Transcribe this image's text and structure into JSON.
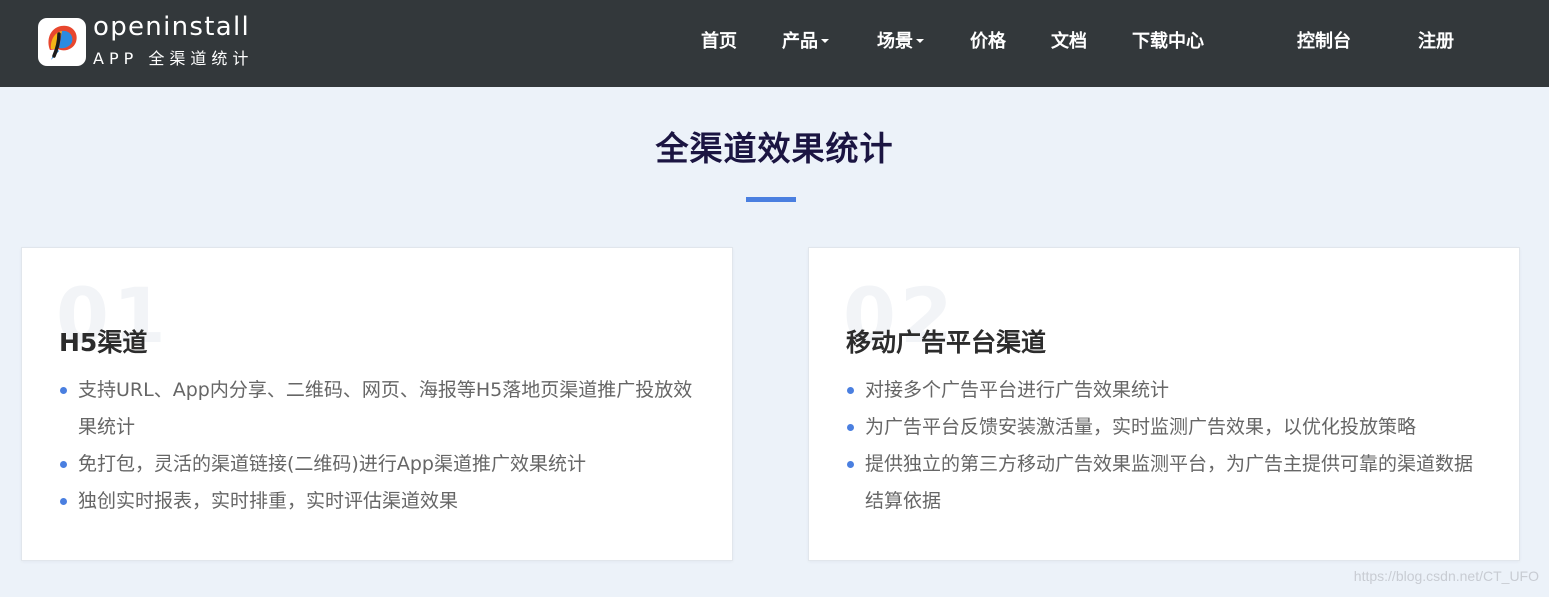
{
  "header": {
    "brand": {
      "name": "openinstall",
      "tagline": "APP 全渠道统计"
    },
    "nav": [
      {
        "label": "首页",
        "has_dropdown": false
      },
      {
        "label": "产品",
        "has_dropdown": true
      },
      {
        "label": "场景",
        "has_dropdown": true
      },
      {
        "label": "价格",
        "has_dropdown": false
      },
      {
        "label": "文档",
        "has_dropdown": false
      },
      {
        "label": "下载中心",
        "has_dropdown": false
      }
    ],
    "console_label": "控制台",
    "register_label": "注册"
  },
  "section": {
    "title": "全渠道效果统计"
  },
  "cards": [
    {
      "number": "01",
      "title": "H5渠道",
      "points": [
        "支持URL、App内分享、二维码、网页、海报等H5落地页渠道推广投放效果统计",
        "免打包，灵活的渠道链接(二维码)进行App渠道推广效果统计",
        "独创实时报表，实时排重，实时评估渠道效果"
      ]
    },
    {
      "number": "02",
      "title": "移动广告平台渠道",
      "points": [
        "对接多个广告平台进行广告效果统计",
        "为广告平台反馈安装激活量，实时监测广告效果，以优化投放策略",
        "提供独立的第三方移动广告效果监测平台，为广告主提供可靠的渠道数据结算依据"
      ]
    }
  ],
  "watermark": "https://blog.csdn.net/CT_UFO",
  "colors": {
    "navbar_bg": "#33383b",
    "page_bg": "#ecf2f9",
    "accent": "#4a7fe0",
    "title": "#1b1542",
    "body_text": "#666666"
  },
  "icons": [
    "openinstall-logo-icon",
    "caret-down-icon",
    "bullet-dot-icon"
  ]
}
